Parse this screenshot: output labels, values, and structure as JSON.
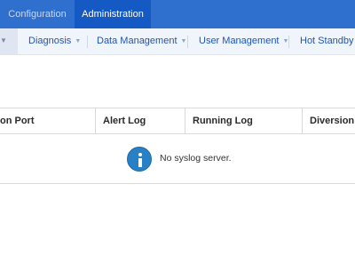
{
  "top_tabs": [
    {
      "label": "Configuration",
      "active": false
    },
    {
      "label": "Administration",
      "active": true
    }
  ],
  "subnav": {
    "items": [
      {
        "label": "Diagnosis"
      },
      {
        "label": "Data Management"
      },
      {
        "label": "User Management"
      },
      {
        "label": "Hot Standby"
      }
    ]
  },
  "table": {
    "columns": [
      "on Port",
      "Alert Log",
      "Running Log",
      "Diversion L"
    ],
    "empty_message": "No syslog server."
  },
  "colors": {
    "topbar": "#2f6fcd",
    "active_tab": "#1459c4",
    "nav_link": "#1f56b3",
    "info_icon": "#2a80c5"
  }
}
